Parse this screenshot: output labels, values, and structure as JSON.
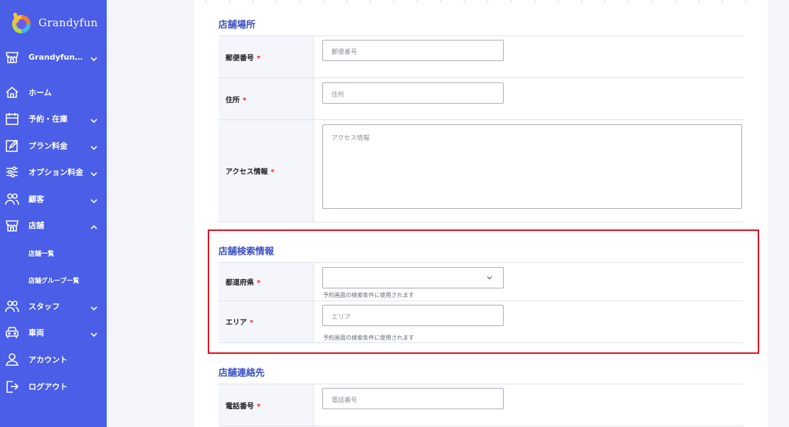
{
  "sidebar": {
    "brand": "Grandyfun",
    "items": [
      {
        "label": "Grandyfun…",
        "icon": "store-icon"
      },
      {
        "label": "ホーム",
        "icon": "home-icon"
      },
      {
        "label": "予約・在庫",
        "icon": "calendar-icon"
      },
      {
        "label": "プラン料金",
        "icon": "edit-icon"
      },
      {
        "label": "オプション料金",
        "icon": "sliders-icon"
      },
      {
        "label": "顧客",
        "icon": "users-icon"
      },
      {
        "label": "店舗",
        "icon": "store-icon"
      },
      {
        "label": "スタッフ",
        "icon": "users-icon"
      },
      {
        "label": "車両",
        "icon": "car-icon"
      },
      {
        "label": "アカウント",
        "icon": "user-icon"
      },
      {
        "label": "ログアウト",
        "icon": "logout-icon"
      }
    ],
    "sub_items": [
      {
        "label": "店舗一覧"
      },
      {
        "label": "店舗グループ一覧"
      }
    ]
  },
  "form": {
    "location": {
      "title": "店舗場所",
      "postal": {
        "label": "郵便番号",
        "required": "*",
        "placeholder": "郵便番号"
      },
      "address": {
        "label": "住所",
        "required": "*",
        "placeholder": "住所"
      },
      "access": {
        "label": "アクセス情報",
        "required": "*",
        "placeholder": "アクセス情報"
      }
    },
    "search": {
      "title": "店舗検索情報",
      "prefecture": {
        "label": "都道府県",
        "required": "*",
        "value": "",
        "help": "予約画面の検索条件に使用されます"
      },
      "area": {
        "label": "エリア",
        "required": "*",
        "placeholder": "エリア",
        "help": "予約画面の検索条件に使用されます"
      }
    },
    "contact": {
      "title": "店舗連絡先",
      "phone": {
        "label": "電話番号",
        "required": "*",
        "placeholder": "電話番号"
      }
    }
  },
  "colors": {
    "sidebar": "#4a5ee8",
    "accent": "#3a50c8",
    "required": "#e0242e",
    "highlight": "#e00b1c"
  }
}
